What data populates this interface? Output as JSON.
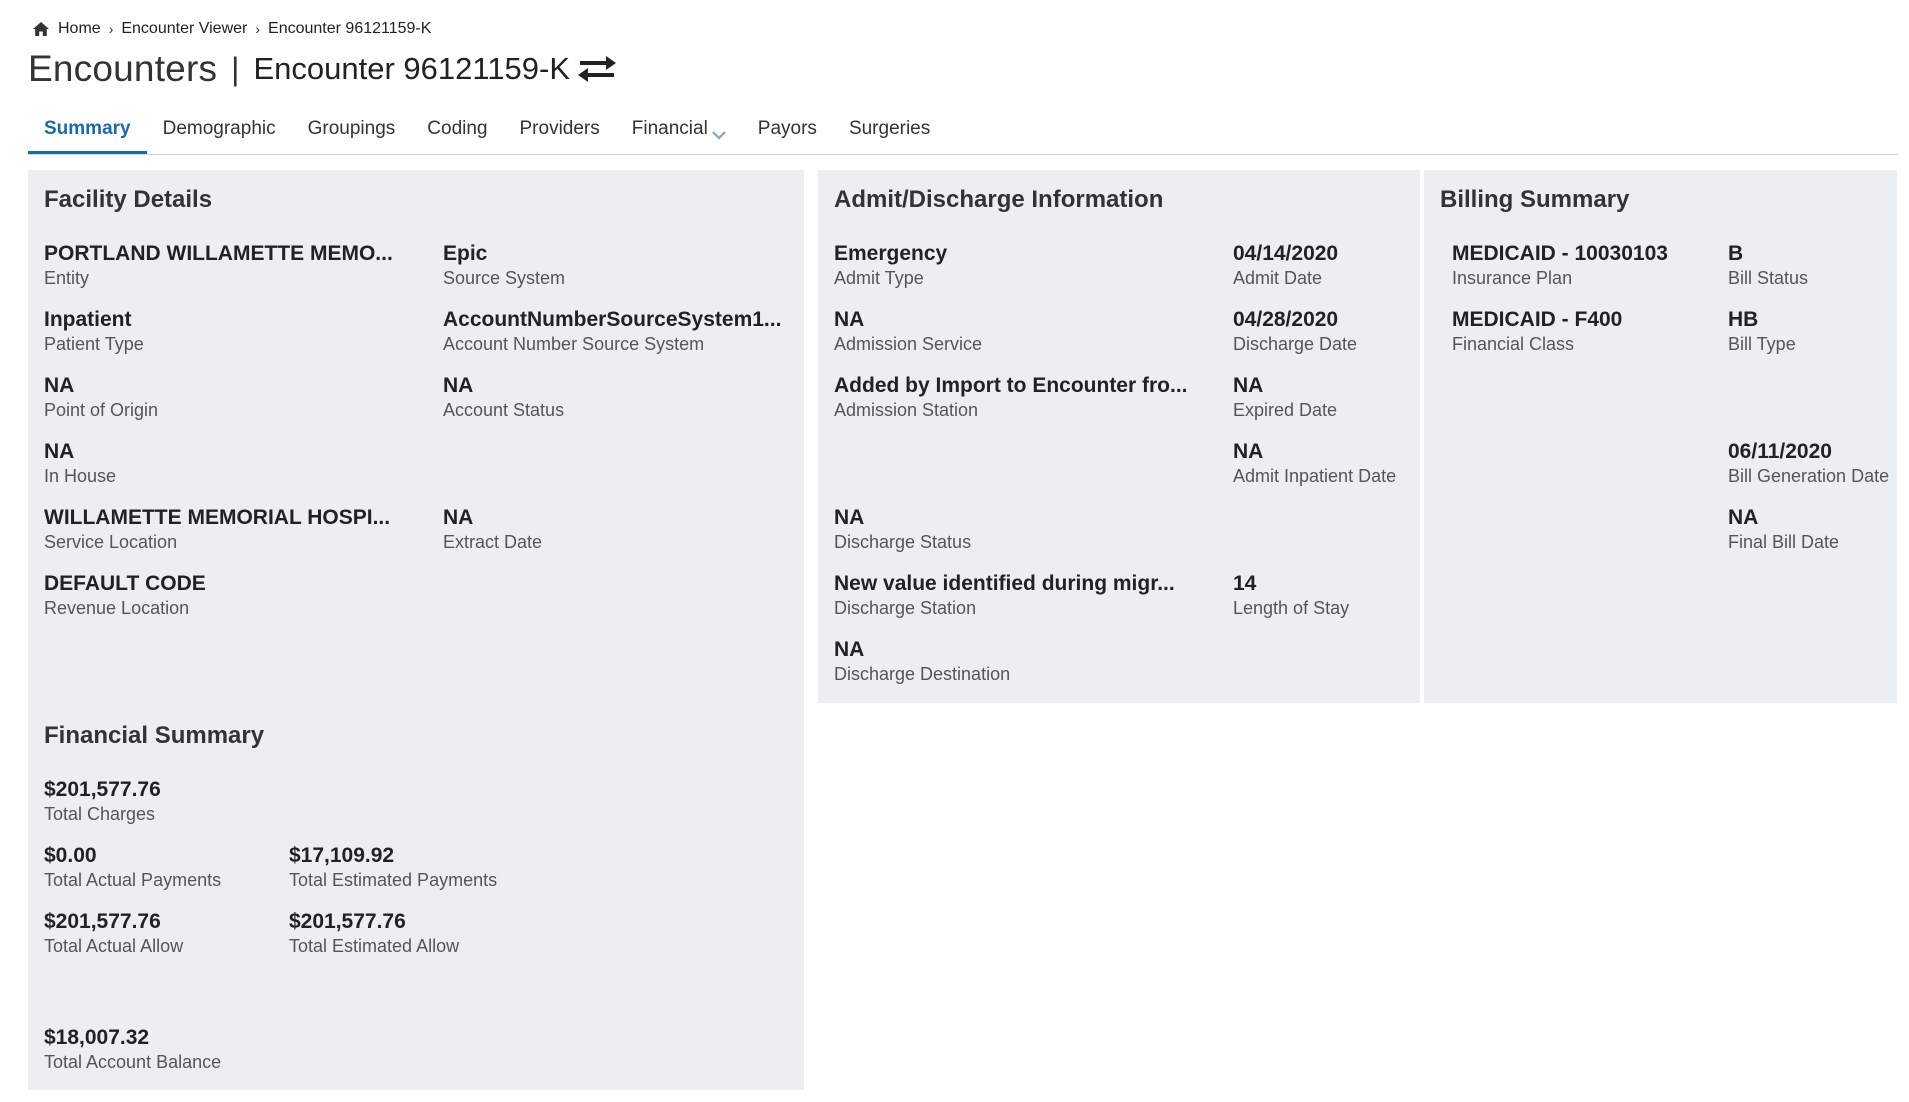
{
  "breadcrumb": {
    "items": [
      "Home",
      "Encounter Viewer",
      "Encounter 96121159-K"
    ],
    "separator": "›"
  },
  "header": {
    "title": "Encounters",
    "divider": "|",
    "subtitle": "Encounter 96121159-K"
  },
  "tabs": [
    {
      "label": "Summary",
      "active": true
    },
    {
      "label": "Demographic"
    },
    {
      "label": "Groupings"
    },
    {
      "label": "Coding"
    },
    {
      "label": "Providers"
    },
    {
      "label": "Financial",
      "has_dropdown": true
    },
    {
      "label": "Payors"
    },
    {
      "label": "Surgeries"
    }
  ],
  "facility": {
    "title": "Facility Details",
    "entity": {
      "value": "PORTLAND WILLAMETTE MEMO...",
      "label": "Entity"
    },
    "source_system": {
      "value": "Epic",
      "label": "Source System"
    },
    "patient_type": {
      "value": "Inpatient",
      "label": "Patient Type"
    },
    "account_number_source": {
      "value": "AccountNumberSourceSystem1...",
      "label": "Account Number Source System"
    },
    "point_of_origin": {
      "value": "NA",
      "label": "Point of Origin"
    },
    "account_status": {
      "value": "NA",
      "label": "Account Status"
    },
    "in_house": {
      "value": "NA",
      "label": "In House"
    },
    "service_location": {
      "value": "WILLAMETTE MEMORIAL HOSPI...",
      "label": "Service Location"
    },
    "extract_date": {
      "value": "NA",
      "label": "Extract Date"
    },
    "revenue_location": {
      "value": "DEFAULT CODE",
      "label": "Revenue Location"
    }
  },
  "admit": {
    "title": "Admit/Discharge Information",
    "admit_type": {
      "value": "Emergency",
      "label": "Admit Type"
    },
    "admit_date": {
      "value": "04/14/2020",
      "label": "Admit Date"
    },
    "admission_service": {
      "value": "NA",
      "label": "Admission Service"
    },
    "discharge_date": {
      "value": "04/28/2020",
      "label": "Discharge Date"
    },
    "admission_station": {
      "value": "Added by Import to Encounter fro...",
      "label": "Admission Station"
    },
    "expired_date": {
      "value": "NA",
      "label": "Expired Date"
    },
    "admit_inpatient_date": {
      "value": "NA",
      "label": "Admit Inpatient Date"
    },
    "discharge_status": {
      "value": "NA",
      "label": "Discharge Status"
    },
    "discharge_station": {
      "value": "New value identified during migr...",
      "label": "Discharge Station"
    },
    "length_of_stay": {
      "value": "14",
      "label": "Length of Stay"
    },
    "discharge_destination": {
      "value": "NA",
      "label": "Discharge Destination"
    }
  },
  "billing": {
    "title": "Billing Summary",
    "insurance_plan": {
      "value": "MEDICAID - 10030103",
      "label": "Insurance Plan"
    },
    "bill_status": {
      "value": "B",
      "label": "Bill Status"
    },
    "financial_class": {
      "value": "MEDICAID - F400",
      "label": "Financial Class"
    },
    "bill_type": {
      "value": "HB",
      "label": "Bill Type"
    },
    "bill_generation_date": {
      "value": "06/11/2020",
      "label": "Bill Generation Date"
    },
    "final_bill_date": {
      "value": "NA",
      "label": "Final Bill Date"
    }
  },
  "financial": {
    "title": "Financial Summary",
    "total_charges": {
      "value": "$201,577.76",
      "label": "Total Charges"
    },
    "total_actual_payments": {
      "value": "$0.00",
      "label": "Total Actual Payments"
    },
    "total_estimated_payments": {
      "value": "$17,109.92",
      "label": "Total Estimated Payments"
    },
    "total_actual_allow": {
      "value": "$201,577.76",
      "label": "Total Actual Allow"
    },
    "total_estimated_allow": {
      "value": "$201,577.76",
      "label": "Total Estimated Allow"
    },
    "total_account_balance": {
      "value": "$18,007.32",
      "label": "Total Account Balance"
    }
  },
  "colors": {
    "accent": "#1d6aa5",
    "panel_bg": "#eceff1"
  }
}
